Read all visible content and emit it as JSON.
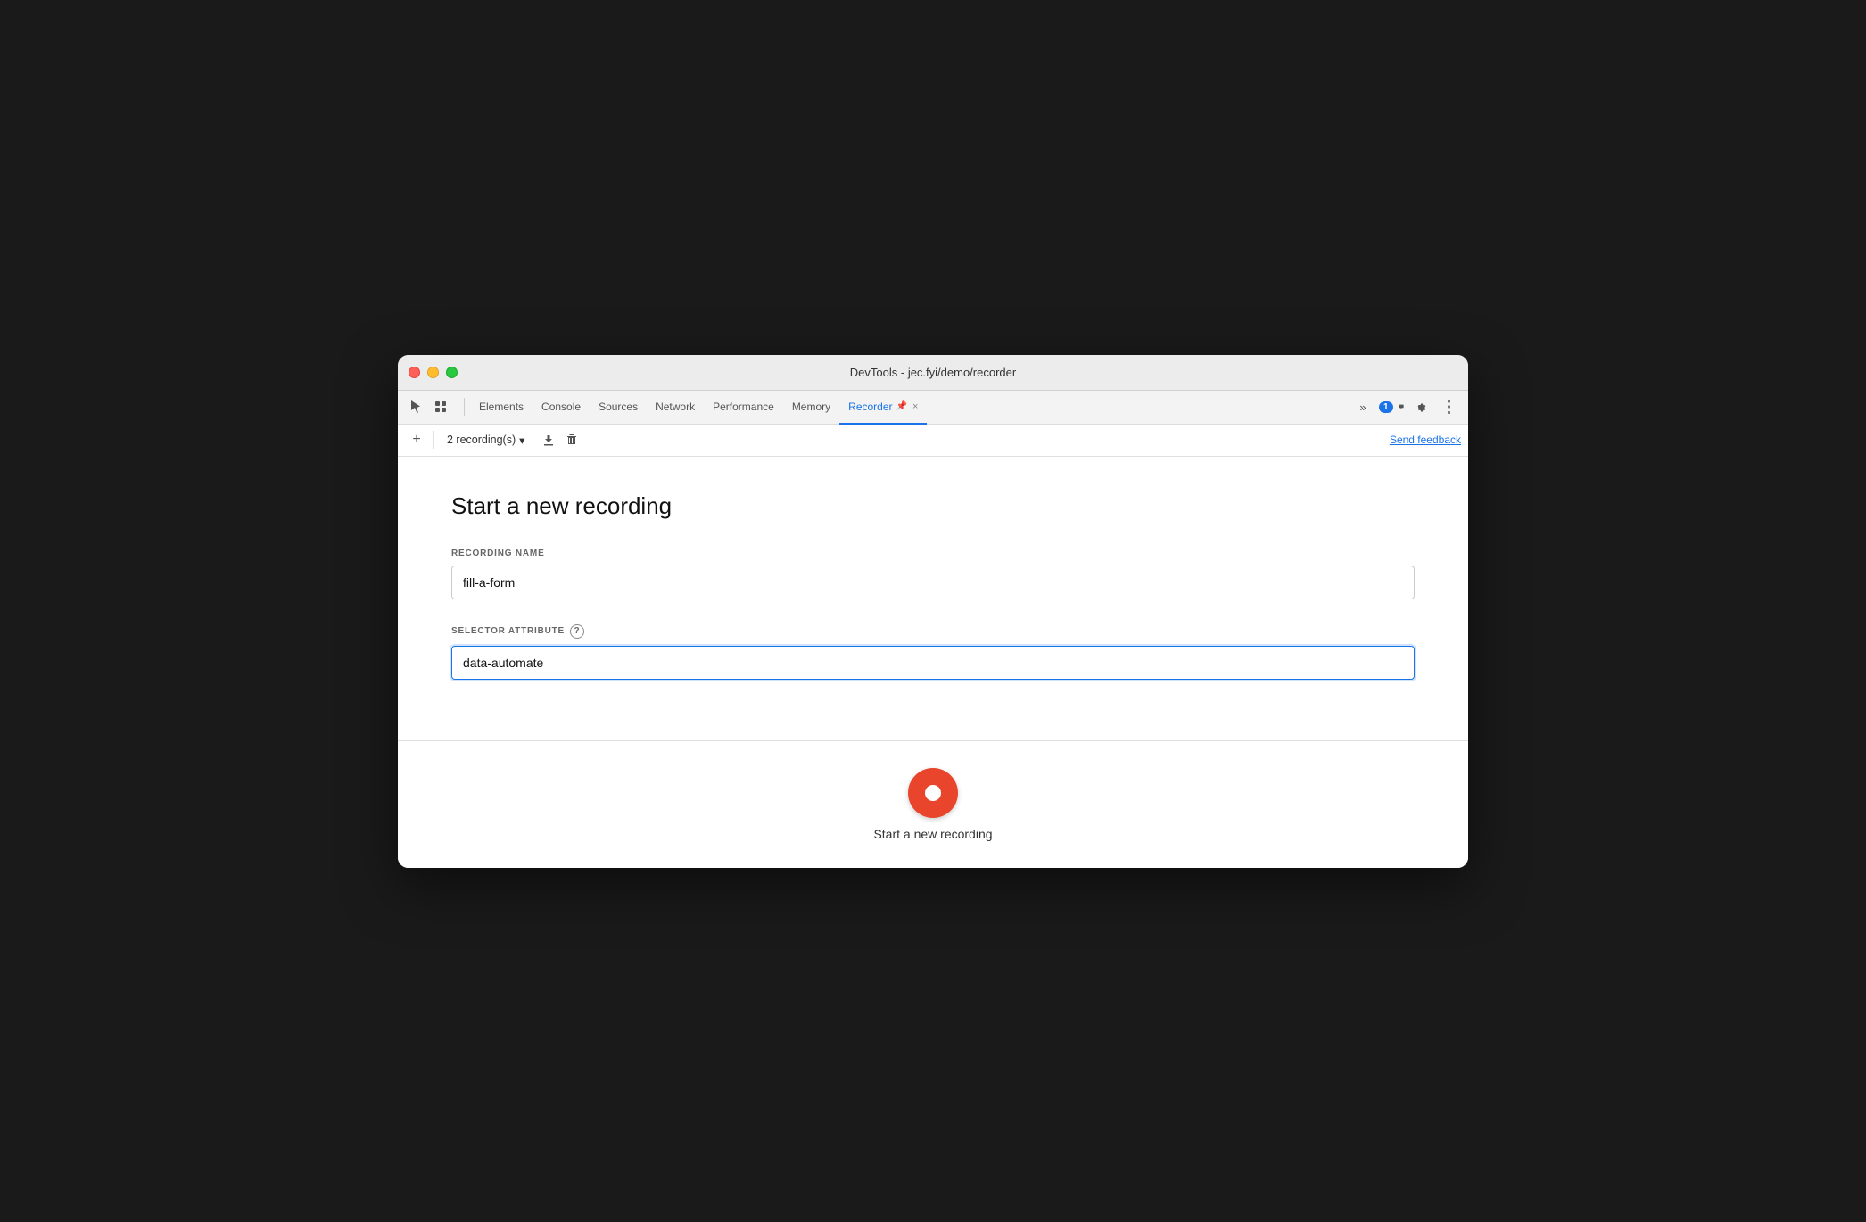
{
  "window": {
    "title": "DevTools - jec.fyi/demo/recorder"
  },
  "tabs": {
    "items": [
      {
        "id": "elements",
        "label": "Elements",
        "active": false
      },
      {
        "id": "console",
        "label": "Console",
        "active": false
      },
      {
        "id": "sources",
        "label": "Sources",
        "active": false
      },
      {
        "id": "network",
        "label": "Network",
        "active": false
      },
      {
        "id": "performance",
        "label": "Performance",
        "active": false
      },
      {
        "id": "memory",
        "label": "Memory",
        "active": false
      },
      {
        "id": "recorder",
        "label": "Recorder",
        "active": true
      }
    ],
    "more_label": "»",
    "close_label": "×",
    "pin_label": "📌"
  },
  "toolbar": {
    "add_label": "+",
    "recording_selector_text": "2 recording(s)",
    "download_label": "⬇",
    "delete_label": "🗑",
    "send_feedback_label": "Send feedback"
  },
  "main": {
    "page_title": "Start a new recording",
    "recording_name_label": "RECORDING NAME",
    "recording_name_value": "fill-a-form",
    "selector_attribute_label": "SELECTOR ATTRIBUTE",
    "selector_attribute_value": "data-automate",
    "record_button_label": "Start a new recording"
  },
  "icons": {
    "cursor": "↖",
    "layers": "⧉",
    "gear": "⚙",
    "more": "⋮",
    "chevron_down": "▾",
    "help": "?",
    "chat_badge": "1"
  },
  "colors": {
    "active_tab": "#1a73e8",
    "record_button": "#e8452c",
    "focused_border": "#1a73e8"
  }
}
